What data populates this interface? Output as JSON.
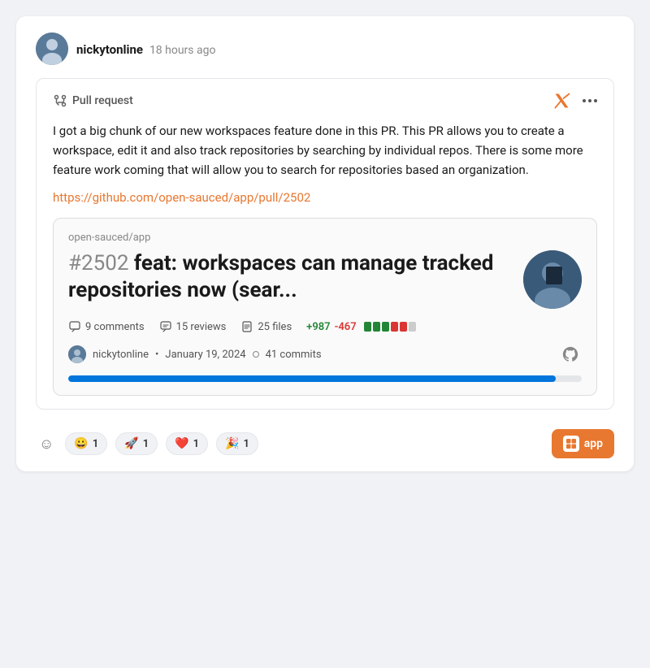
{
  "header": {
    "username": "nickytonline",
    "timestamp": "18 hours ago",
    "avatar_label": "nickytonline avatar"
  },
  "post": {
    "pr_label": "Pull request",
    "body": "I got a big chunk of our new workspaces feature done in this PR. This PR allows you to create a workspace, edit it and also track repositories by searching by individual repos. There is some more feature work coming that will allow you to search for repositories based an organization.",
    "link": "https://github.com/open-sauced/app/pull/2502",
    "pr_card": {
      "repo": "open-sauced/app",
      "number": "#2502",
      "title": "feat: workspaces can manage tracked repositories now (sear...",
      "stats": {
        "comments": "9 comments",
        "reviews": "15 reviews",
        "files": "25 files",
        "additions": "+987",
        "deletions": "-467",
        "diff_bars": [
          "green",
          "green",
          "green",
          "red",
          "red",
          "gray"
        ]
      },
      "author": "nickytonline",
      "date": "January 19, 2024",
      "commits": "41 commits",
      "progress": 95
    }
  },
  "reactions": [
    {
      "emoji": "😀",
      "count": "1"
    },
    {
      "emoji": "🚀",
      "count": "1"
    },
    {
      "emoji": "❤️",
      "count": "1"
    },
    {
      "emoji": "🎉",
      "count": "1"
    }
  ],
  "app_button": "app",
  "icons": {
    "x_label": "X (Twitter)",
    "more_label": "more options",
    "emoji_add_label": "add reaction",
    "github_label": "GitHub",
    "pr_icon_label": "pull request icon"
  }
}
